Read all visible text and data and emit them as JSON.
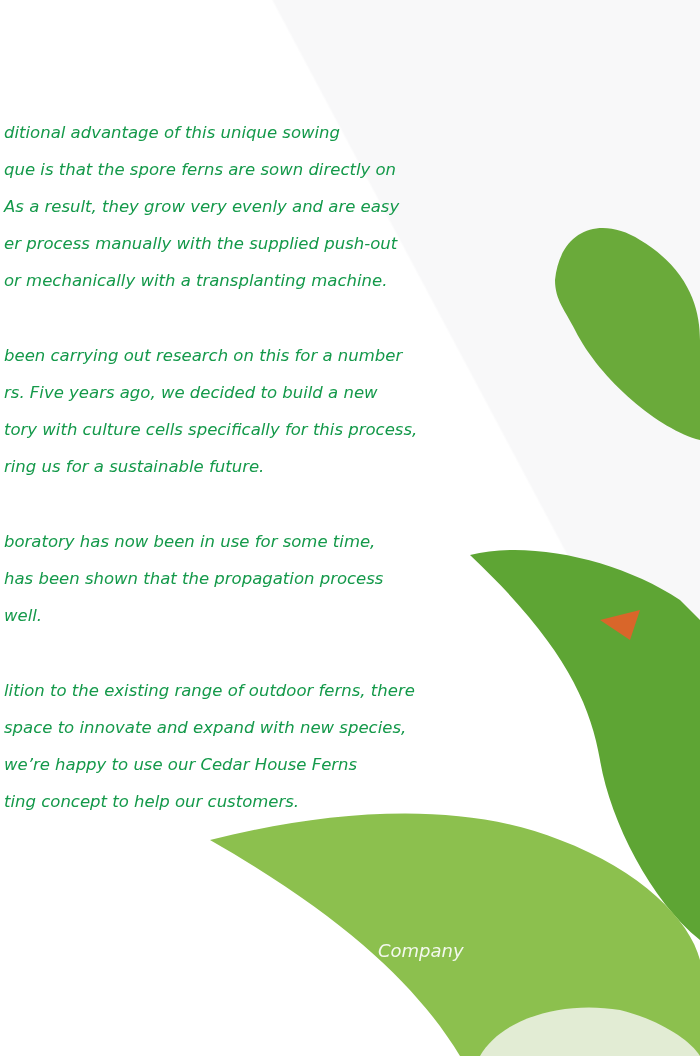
{
  "paragraphs": [
    {
      "lines": [
        "ditional advantage of this unique sowing",
        "que is that the spore ferns are sown directly on",
        "As a result, they grow very evenly and are easy",
        "er process manually with the supplied push-out",
        "or mechanically with a transplanting machine."
      ]
    },
    {
      "lines": [
        "been carrying out research on this for a number",
        "rs. Five years ago, we decided to build a new",
        "tory with culture cells specifically for this process,",
        "ring us for a sustainable future."
      ]
    },
    {
      "lines": [
        "boratory has now been in use for some time,",
        "has been shown that the propagation process",
        "well."
      ]
    },
    {
      "lines": [
        "lition to the existing range of outdoor ferns, there",
        "space to innovate and expand with new species,",
        "we’re happy to use our Cedar House Ferns",
        "ting concept to help our customers."
      ]
    }
  ],
  "caption": "Company"
}
